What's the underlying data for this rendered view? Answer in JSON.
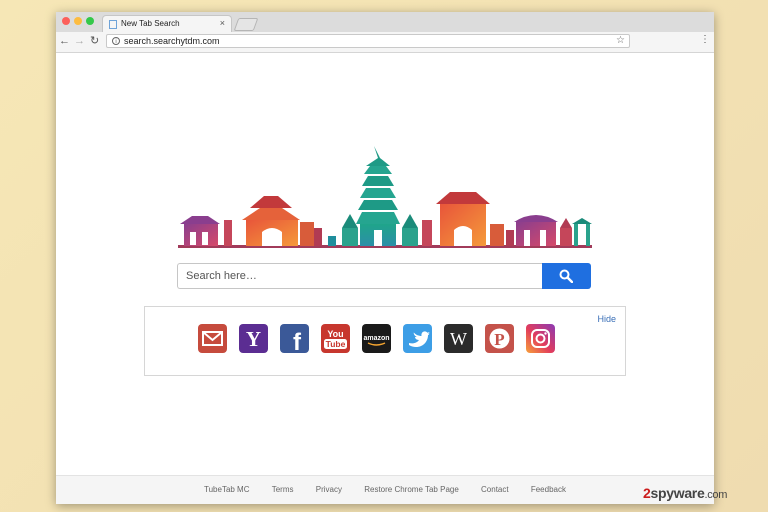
{
  "browser": {
    "tab": {
      "title": "New Tab Search",
      "close_glyph": "×"
    },
    "toolbar": {
      "back_glyph": "←",
      "forward_glyph": "→",
      "reload_glyph": "↻",
      "url": "search.searchytdm.com",
      "info_glyph": "i",
      "star_glyph": "☆",
      "menu_glyph": "⋮"
    }
  },
  "search": {
    "placeholder": "Search here…",
    "button_icon": "magnifier-icon"
  },
  "quick_links": {
    "hide_label": "Hide",
    "items": [
      {
        "name": "gmail",
        "icon": "mail-icon",
        "color": "#c64b3d"
      },
      {
        "name": "yahoo",
        "icon": "yahoo-icon",
        "label": "Y",
        "color": "#5b2d92"
      },
      {
        "name": "facebook",
        "icon": "facebook-icon",
        "label": "f",
        "color": "#3b5998"
      },
      {
        "name": "youtube",
        "icon": "youtube-icon",
        "label_top": "You",
        "label_bottom": "Tube",
        "color": "#c7372e"
      },
      {
        "name": "amazon",
        "icon": "amazon-icon",
        "label": "amazon",
        "color": "#1a1a1a"
      },
      {
        "name": "twitter",
        "icon": "twitter-icon",
        "color": "#3d9ee6"
      },
      {
        "name": "wikipedia",
        "icon": "wikipedia-icon",
        "label": "W",
        "color": "#2b2b2b"
      },
      {
        "name": "pinterest",
        "icon": "pinterest-icon",
        "label": "P",
        "color": "#c4524a"
      },
      {
        "name": "instagram",
        "icon": "instagram-icon",
        "color": "#b5337f"
      }
    ]
  },
  "footer": {
    "links": [
      "TubeTab MC",
      "Terms",
      "Privacy",
      "Restore Chrome Tab Page",
      "Contact",
      "Feedback"
    ]
  },
  "watermark": {
    "two": "2",
    "spyware": "spyware",
    "com": ".com"
  }
}
